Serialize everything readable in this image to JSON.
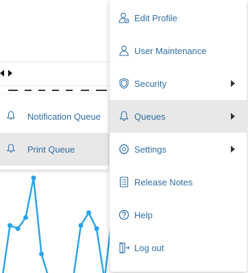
{
  "colors": {
    "accent": "#2f6ea3",
    "chart_line": "#2aa3e8",
    "active_bg": "#e8e8e8"
  },
  "menu": {
    "items": [
      {
        "label": "Edit Profile",
        "icon": "user-edit-icon"
      },
      {
        "label": "User Maintenance",
        "icon": "user-icon"
      },
      {
        "label": "Security",
        "icon": "shield-icon",
        "has_submenu": true
      },
      {
        "label": "Queues",
        "icon": "bell-icon",
        "has_submenu": true,
        "active": true
      },
      {
        "label": "Settings",
        "icon": "gear-icon",
        "has_submenu": true
      },
      {
        "label": "Release Notes",
        "icon": "list-icon"
      },
      {
        "label": "Help",
        "icon": "question-icon"
      },
      {
        "label": "Log out",
        "icon": "logout-icon"
      }
    ]
  },
  "submenu": {
    "items": [
      {
        "label": "Notification Queue",
        "icon": "bell-icon"
      },
      {
        "label": "Print Queue",
        "icon": "bell-icon",
        "active": true
      }
    ]
  },
  "chart_data": {
    "type": "line",
    "series": [
      {
        "values": [
          0,
          30,
          28,
          35,
          60,
          12,
          0,
          0,
          0,
          0,
          30,
          38,
          28,
          0,
          38
        ]
      }
    ]
  }
}
